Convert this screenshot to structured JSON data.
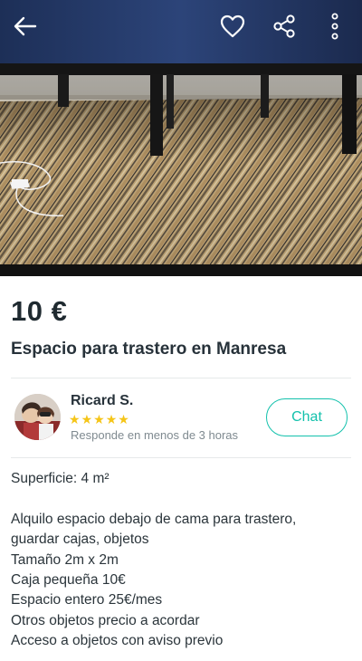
{
  "listing": {
    "price": "10 €",
    "title": "Espacio para trastero en Manresa"
  },
  "seller": {
    "name": "Ricard S.",
    "rating_stars": 5,
    "stars": [
      "★",
      "★",
      "★",
      "★",
      "★"
    ],
    "response_time": "Responde en menos de 3 horas",
    "chat_label": "Chat"
  },
  "description": {
    "surface": "Superficie: 4 m²",
    "lines": [
      "Alquilo espacio debajo de cama para trastero,",
      "guardar cajas, objetos",
      "Tamaño 2m x 2m",
      "Caja pequeña 10€",
      "Espacio entero 25€/mes",
      "Otros objetos precio a acordar",
      "Acceso a objetos con aviso previo"
    ]
  },
  "icons": {
    "back": "arrow-left-icon",
    "favorite": "heart-icon",
    "share": "share-icon",
    "more": "more-vertical-icon"
  },
  "colors": {
    "accent": "#13c1ac",
    "star": "#f5c518",
    "text": "#1f2a30",
    "muted": "#7f8a90"
  }
}
